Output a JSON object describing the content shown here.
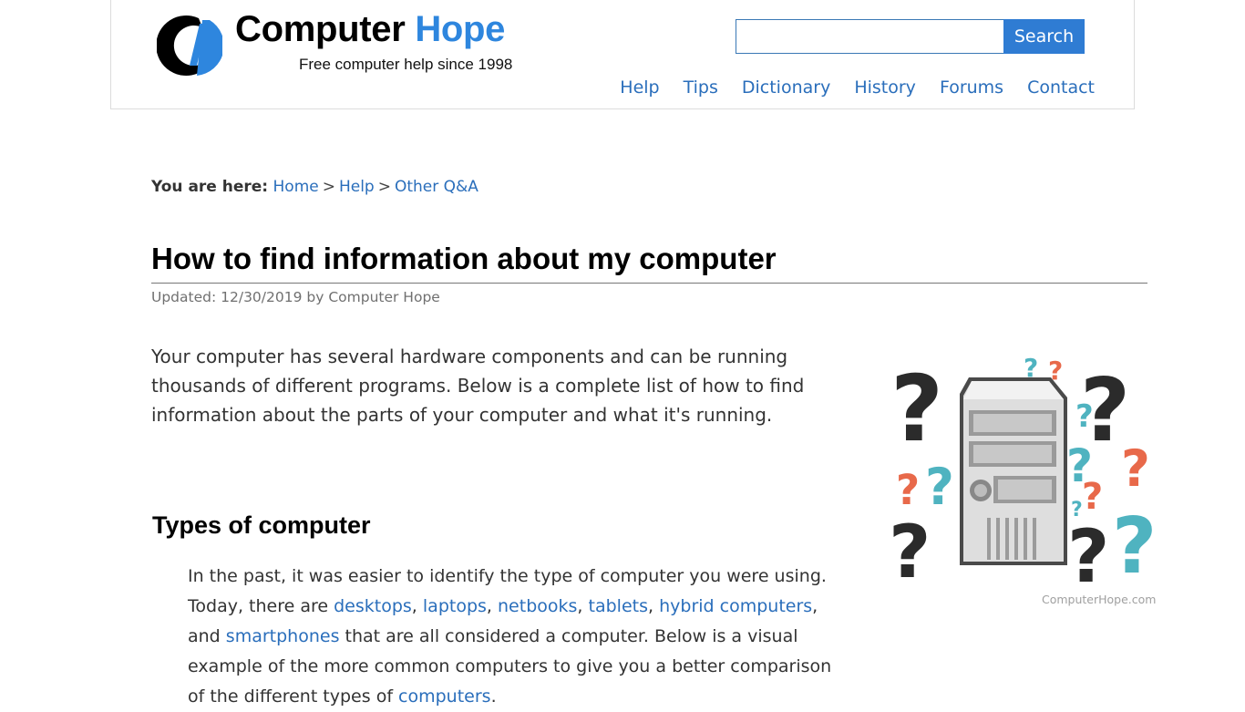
{
  "header": {
    "logo_title_main": "Computer",
    "logo_title_accent": "Hope",
    "logo_tagline": "Free computer help since 1998",
    "search": {
      "value": "",
      "placeholder": "",
      "button_label": "Search"
    },
    "nav": [
      {
        "label": "Help"
      },
      {
        "label": "Tips"
      },
      {
        "label": "Dictionary"
      },
      {
        "label": "History"
      },
      {
        "label": "Forums"
      },
      {
        "label": "Contact"
      }
    ]
  },
  "breadcrumb": {
    "label": "You are here:",
    "separator": ">",
    "items": [
      {
        "label": "Home"
      },
      {
        "label": "Help"
      },
      {
        "label": "Other Q&A"
      }
    ]
  },
  "article": {
    "title": "How to find information about my computer",
    "updated": "Updated: 12/30/2019 by Computer Hope",
    "intro": "Your computer has several hardware components and can be running thousands of different programs. Below is a complete list of how to find information about the parts of your computer and what it's running.",
    "image_caption": "ComputerHope.com",
    "sections": [
      {
        "title": "Types of computer",
        "p1": "In the past, it was easier to identify the type of computer you were using. Today, there are ",
        "links": [
          "desktops",
          "laptops",
          "netbooks",
          "tablets",
          "hybrid computers",
          "smartphones",
          "computers"
        ],
        "sep_comma": ", ",
        "and_text": ", and ",
        "p2": " that are all considered a computer. Below is a visual example of the more common computers to give you a better comparison of the different types of ",
        "p3": "."
      }
    ]
  },
  "colors": {
    "accent": "#2e86de",
    "link": "#2a6ebb",
    "search_button": "#2f7cd3",
    "teal": "#4fb3c0",
    "orange": "#e8694a"
  }
}
